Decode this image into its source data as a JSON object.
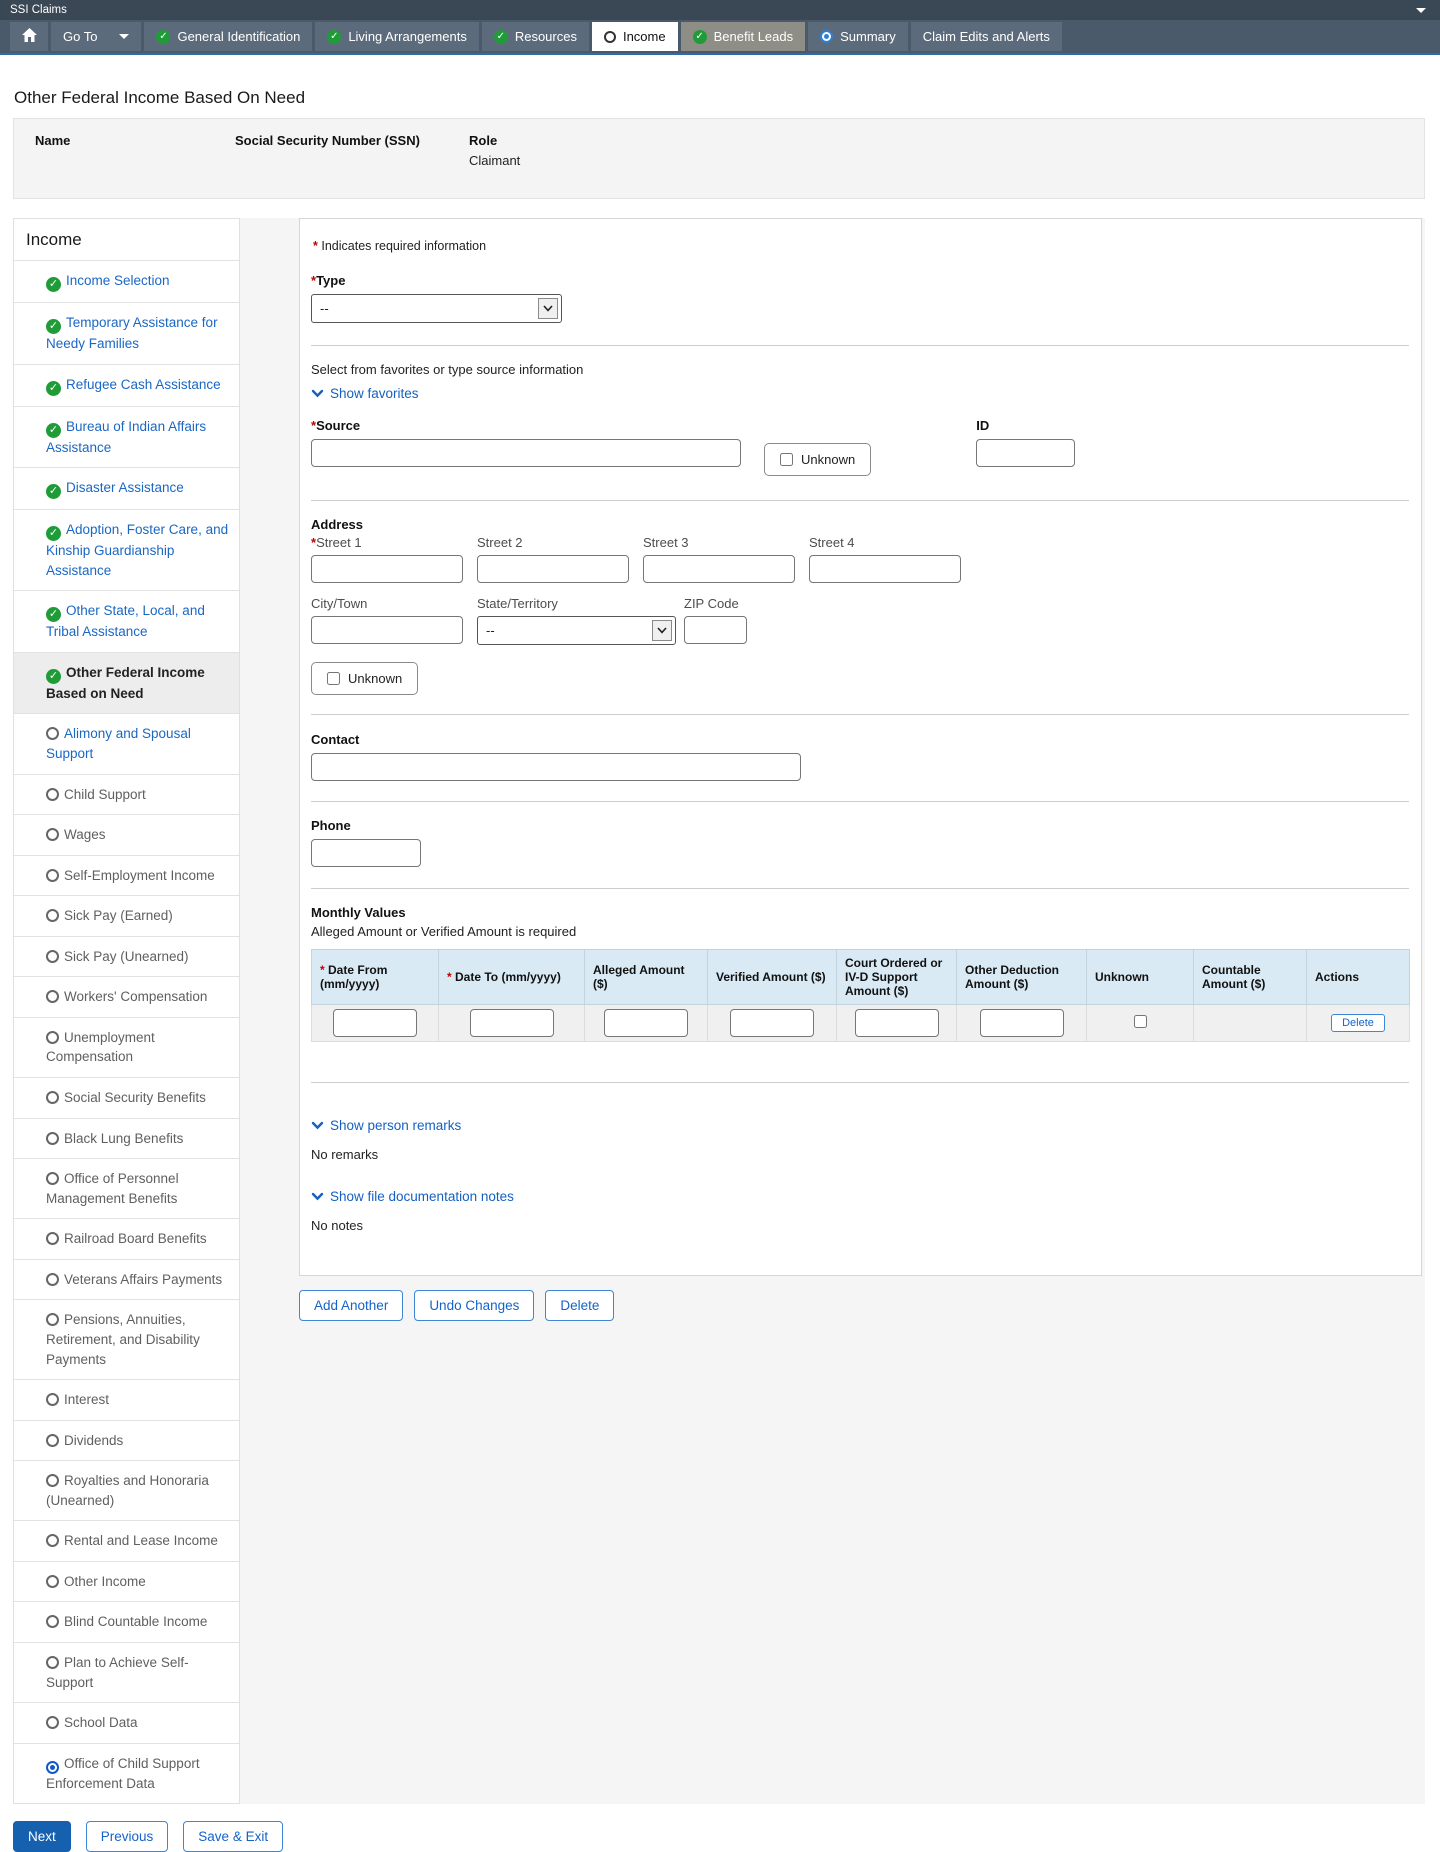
{
  "app": {
    "title": "SSI Claims"
  },
  "nav": {
    "goto_label": "Go To",
    "tabs": [
      {
        "label": "General Identification",
        "icon": "check",
        "state": "default"
      },
      {
        "label": "Living Arrangements",
        "icon": "check",
        "state": "default"
      },
      {
        "label": "Resources",
        "icon": "check",
        "state": "default"
      },
      {
        "label": "Income",
        "icon": "circle",
        "state": "active"
      },
      {
        "label": "Benefit Leads",
        "icon": "check",
        "state": "highlight"
      },
      {
        "label": "Summary",
        "icon": "target",
        "state": "default"
      },
      {
        "label": "Claim Edits and Alerts",
        "icon": "none",
        "state": "default"
      }
    ]
  },
  "header": {
    "page_title": "Other Federal Income Based On Need",
    "person": {
      "name_label": "Name",
      "ssn_label": "Social Security Number (SSN)",
      "role_label": "Role",
      "role_value": "Claimant"
    }
  },
  "sidebar": {
    "title": "Income",
    "items": [
      {
        "label": "Income Selection",
        "status": "complete"
      },
      {
        "label": "Temporary Assistance for Needy Families",
        "status": "complete"
      },
      {
        "label": "Refugee Cash Assistance",
        "status": "complete"
      },
      {
        "label": "Bureau of Indian Affairs Assistance",
        "status": "complete"
      },
      {
        "label": "Disaster Assistance",
        "status": "complete"
      },
      {
        "label": "Adoption, Foster Care, and Kinship Guardianship Assistance",
        "status": "complete"
      },
      {
        "label": "Other State, Local, and Tribal Assistance",
        "status": "complete"
      },
      {
        "label": "Other Federal Income Based on Need",
        "status": "active"
      },
      {
        "label": "Alimony and Spousal Support",
        "status": "open-link"
      },
      {
        "label": "Child Support",
        "status": "open"
      },
      {
        "label": "Wages",
        "status": "open"
      },
      {
        "label": "Self-Employment Income",
        "status": "open"
      },
      {
        "label": "Sick Pay (Earned)",
        "status": "open"
      },
      {
        "label": "Sick Pay (Unearned)",
        "status": "open"
      },
      {
        "label": "Workers' Compensation",
        "status": "open"
      },
      {
        "label": "Unemployment Compensation",
        "status": "open"
      },
      {
        "label": "Social Security Benefits",
        "status": "open"
      },
      {
        "label": "Black Lung Benefits",
        "status": "open"
      },
      {
        "label": "Office of Personnel Management Benefits",
        "status": "open"
      },
      {
        "label": "Railroad Board Benefits",
        "status": "open"
      },
      {
        "label": "Veterans Affairs Payments",
        "status": "open"
      },
      {
        "label": "Pensions, Annuities, Retirement, and Disability Payments",
        "status": "open"
      },
      {
        "label": "Interest",
        "status": "open"
      },
      {
        "label": "Dividends",
        "status": "open"
      },
      {
        "label": "Royalties and Honoraria (Unearned)",
        "status": "open"
      },
      {
        "label": "Rental and Lease Income",
        "status": "open"
      },
      {
        "label": "Other Income",
        "status": "open"
      },
      {
        "label": "Blind Countable Income",
        "status": "open"
      },
      {
        "label": "Plan to Achieve Self-Support",
        "status": "open"
      },
      {
        "label": "School Data",
        "status": "open"
      },
      {
        "label": "Office of Child Support Enforcement Data",
        "status": "radio-selected"
      }
    ]
  },
  "form": {
    "required_marker": "*",
    "required_note": "Indicates required information",
    "type": {
      "label": "Type",
      "value": "--"
    },
    "favorites": {
      "hint": "Select from favorites or type source information",
      "toggle": "Show favorites"
    },
    "source": {
      "label": "Source",
      "unknown_label": "Unknown",
      "id_label": "ID"
    },
    "address": {
      "label": "Address",
      "street1_label": "Street 1",
      "street2_label": "Street 2",
      "street3_label": "Street 3",
      "street4_label": "Street 4",
      "city_label": "City/Town",
      "state_label": "State/Territory",
      "state_value": "--",
      "zip_label": "ZIP Code",
      "unknown_label": "Unknown"
    },
    "contact": {
      "label": "Contact"
    },
    "phone": {
      "label": "Phone"
    },
    "monthly_values": {
      "title": "Monthly Values",
      "subtitle": "Alleged Amount or Verified Amount is required",
      "columns": [
        {
          "label": "Date From (mm/yyyy)",
          "required": true,
          "cell": "input"
        },
        {
          "label": "Date To (mm/yyyy)",
          "required": true,
          "cell": "input"
        },
        {
          "label": "Alleged Amount ($)",
          "required": false,
          "cell": "input"
        },
        {
          "label": "Verified Amount ($)",
          "required": false,
          "cell": "input"
        },
        {
          "label": "Court Ordered or IV-D Support Amount ($)",
          "required": false,
          "cell": "input"
        },
        {
          "label": "Other Deduction Amount ($)",
          "required": false,
          "cell": "input"
        },
        {
          "label": "Unknown",
          "required": false,
          "cell": "checkbox"
        },
        {
          "label": "Countable Amount ($)",
          "required": false,
          "cell": "empty"
        },
        {
          "label": "Actions",
          "required": false,
          "cell": "action"
        }
      ],
      "row_action": "Delete"
    },
    "remarks": {
      "toggle": "Show person remarks",
      "empty": "No remarks"
    },
    "notes": {
      "toggle": "Show file documentation notes",
      "empty": "No notes"
    },
    "actions": {
      "add": "Add Another",
      "undo": "Undo Changes",
      "delete": "Delete"
    }
  },
  "footer": {
    "next": "Next",
    "previous": "Previous",
    "save_exit": "Save & Exit"
  },
  "colors": {
    "titlebar": "#3a4856",
    "navbar": "#4a5a6b",
    "tab": "#5b6b7c",
    "tab_highlight": "#8e8e87",
    "accent_blue": "#1660c1",
    "primary_button": "#1560af",
    "check_green": "#1f9c38",
    "table_header_bg": "#d9eaf5",
    "required_red": "#c00000"
  }
}
